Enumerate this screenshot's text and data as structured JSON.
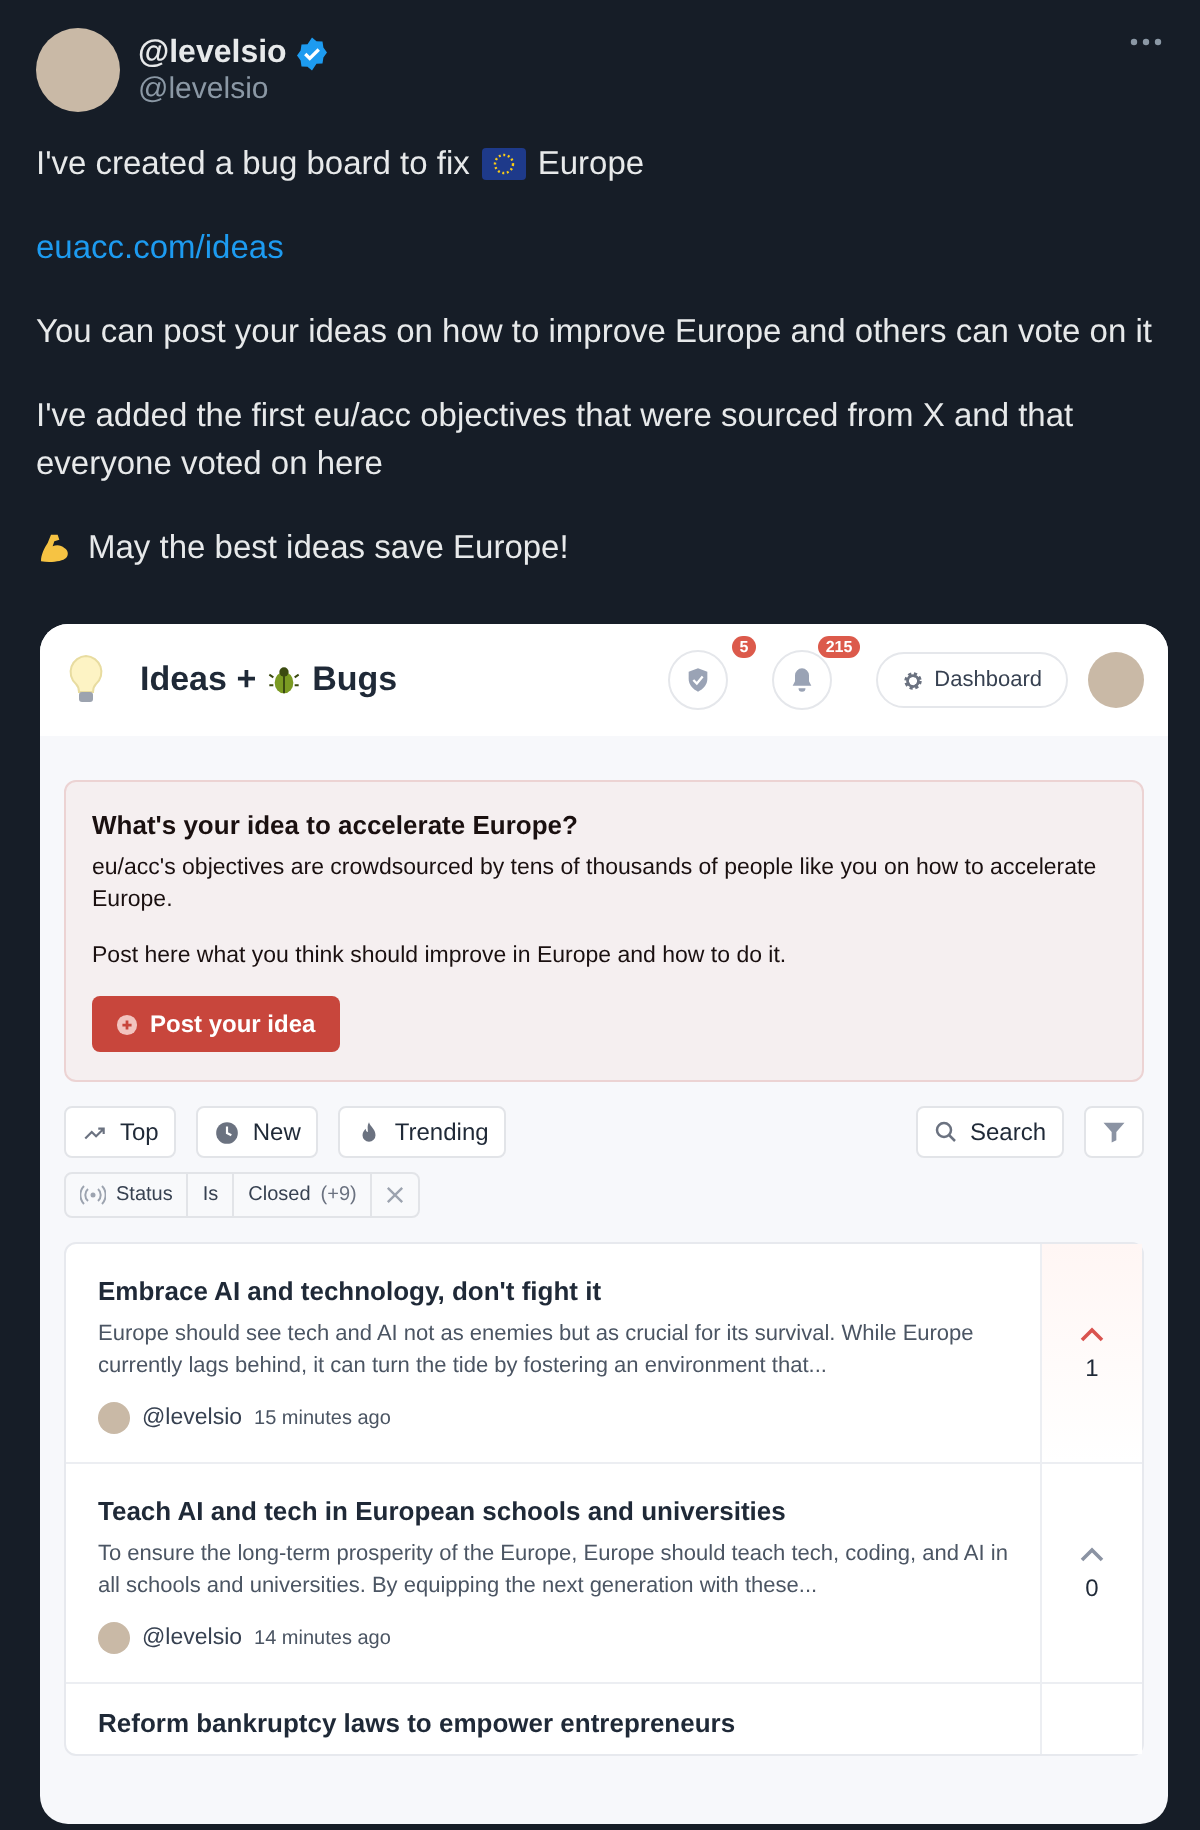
{
  "post": {
    "name": "@levelsio",
    "verified": true,
    "handle": "@levelsio",
    "paragraphs": [
      {
        "kind": "flag",
        "before": "I've created a bug board to fix",
        "after": "Europe"
      },
      {
        "kind": "link",
        "text": "euacc.com/ideas"
      },
      {
        "kind": "text",
        "text": "You can post your ideas on how to improve Europe and others can vote on it"
      },
      {
        "kind": "text",
        "text": "I've added the first eu/acc objectives that were sourced from X and that everyone voted on here"
      },
      {
        "kind": "arm",
        "text": "May the best ideas save Europe!"
      }
    ]
  },
  "app": {
    "title_before": "Ideas +",
    "title_after": "Bugs",
    "notifications": [
      {
        "kind": "shield",
        "count": "5"
      },
      {
        "kind": "bell",
        "count": "215"
      }
    ],
    "dashboard": "Dashboard",
    "prompt": {
      "title": "What's your idea to accelerate Europe?",
      "body": [
        "eu/acc's objectives are crowdsourced by tens of thousands of people like you on how to accelerate Europe.",
        "Post here what you think should improve in Europe and how to do it."
      ],
      "button": "Post your idea"
    },
    "sorts": [
      {
        "kind": "top",
        "label": "Top"
      },
      {
        "kind": "new",
        "label": "New"
      },
      {
        "kind": "trending",
        "label": "Trending"
      }
    ],
    "search": "Search",
    "filter": {
      "field": "Status",
      "operator": "Is",
      "value": "Closed",
      "extra": "(+9)"
    },
    "ideas": [
      {
        "title": "Embrace AI and technology, don't fight it",
        "summary": "Europe should see tech and AI not as enemies but as crucial for its survival. While Europe currently lags behind, it can turn the tide by fostering an environment that...",
        "author": "@levelsio",
        "time": "15 minutes ago",
        "votes": "1",
        "voted": true
      },
      {
        "title": "Teach AI and tech in European schools and universities",
        "summary": "To ensure the long-term prosperity of the Europe, Europe should teach tech, coding, and AI in all schools and universities. By equipping the next generation with these...",
        "author": "@levelsio",
        "time": "14 minutes ago",
        "votes": "0",
        "voted": false
      },
      {
        "title": "Reform bankruptcy laws to empower entrepreneurs"
      }
    ]
  }
}
